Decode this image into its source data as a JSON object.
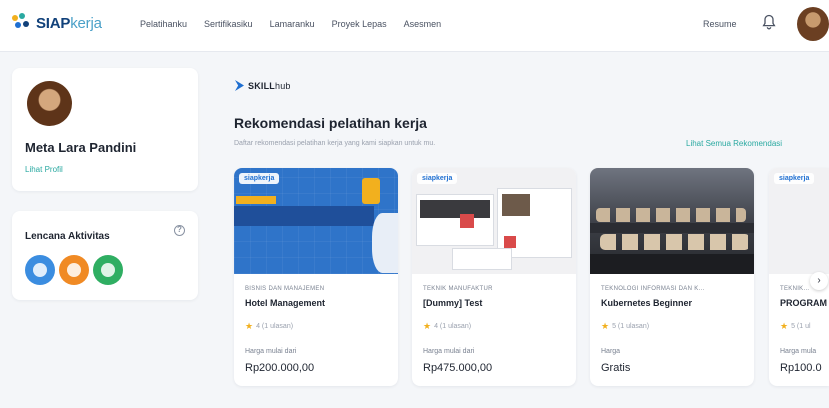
{
  "brand": {
    "name_bold": "SIAP",
    "name_light": "kerja"
  },
  "nav": {
    "items": [
      "Pelatihanku",
      "Sertifikasiku",
      "Lamaranku",
      "Proyek Lepas",
      "Asesmen"
    ],
    "resume": "Resume",
    "bell_icon": "bell-icon"
  },
  "profile": {
    "name": "Meta Lara Pandini",
    "link": "Lihat Profil"
  },
  "badges": {
    "title": "Lencana Aktivitas",
    "help": "?",
    "items": [
      {
        "icon": "document-badge-icon",
        "color": "#3b8de0"
      },
      {
        "icon": "person-badge-icon",
        "color": "#f08a24"
      },
      {
        "icon": "check-badge-icon",
        "color": "#2fae62"
      }
    ]
  },
  "main": {
    "partner": {
      "bold": "SKILL",
      "light": "hub"
    },
    "title": "Rekomendasi pelatihan kerja",
    "subtitle": "Daftar rekomendasi pelatihan kerja yang kami siapkan untuk mu.",
    "see_all": "Lihat Semua Rekomendasi",
    "next_icon": "›",
    "courses": [
      {
        "chip": "siapkerja",
        "category": "BISNIS DAN MANAJEMEN",
        "title": "Hotel Management",
        "rating": "4 (1 ulasan)",
        "price_label": "Harga mulai dari",
        "price": "Rp200.000,00"
      },
      {
        "chip": "siapkerja",
        "category": "TEKNIK MANUFAKTUR",
        "title": "[Dummy] Test",
        "rating": "4 (1 ulasan)",
        "price_label": "Harga mulai dari",
        "price": "Rp475.000,00"
      },
      {
        "chip": "",
        "category": "TEKNOLOGI INFORMASI DAN K...",
        "title": "Kubernetes Beginner",
        "rating": "5 (1 ulasan)",
        "price_label": "Harga",
        "price": "Gratis"
      },
      {
        "chip": "siapkerja",
        "category": "TEKNIK...",
        "title": "PROGRAM",
        "rating": "5 (1 ul",
        "price_label": "Harga mula",
        "price": "Rp100.0"
      }
    ]
  },
  "colors": {
    "accent": "#2aa9a1",
    "brand": "#11417a",
    "star": "#f2b01e"
  }
}
